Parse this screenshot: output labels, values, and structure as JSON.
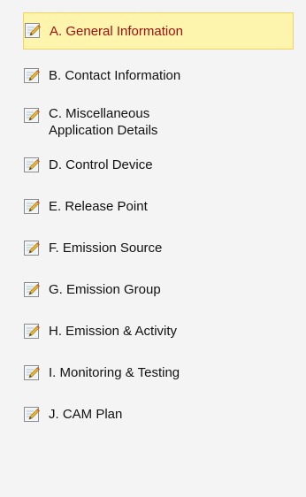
{
  "nav": {
    "items": [
      {
        "label": "A. General Information",
        "active": true
      },
      {
        "label": "B. Contact Information",
        "active": false
      },
      {
        "label": "C. Miscellaneous Application Details",
        "active": false
      },
      {
        "label": "D. Control Device",
        "active": false
      },
      {
        "label": "E. Release Point",
        "active": false
      },
      {
        "label": "F. Emission Source",
        "active": false
      },
      {
        "label": "G. Emission Group",
        "active": false
      },
      {
        "label": "H. Emission & Activity",
        "active": false
      },
      {
        "label": "I. Monitoring & Testing",
        "active": false
      },
      {
        "label": "J. CAM Plan",
        "active": false
      }
    ],
    "icon": "edit-form-icon",
    "active_bg": "#fdf5ad",
    "active_border": "#f0d360",
    "active_text": "#a01010"
  }
}
